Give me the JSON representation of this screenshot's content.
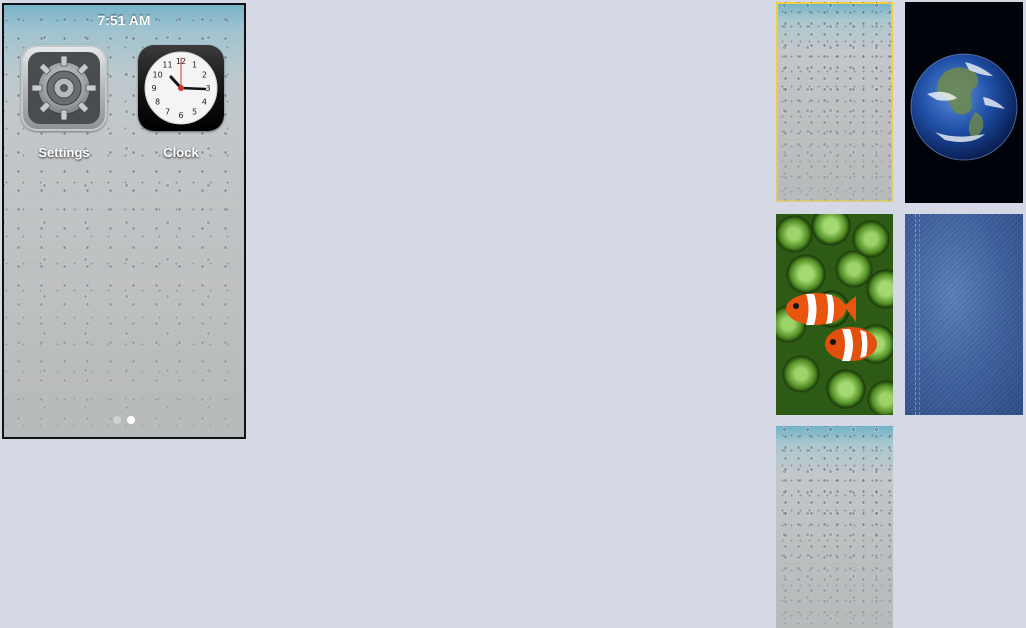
{
  "phone": {
    "status_time": "7:51 AM",
    "apps": [
      {
        "label": "Settings",
        "icon": "settings-gear-icon"
      },
      {
        "label": "Clock",
        "icon": "clock-icon"
      }
    ],
    "clock_numerals": [
      "12",
      "1",
      "2",
      "3",
      "4",
      "5",
      "6",
      "7",
      "8",
      "9",
      "10",
      "11"
    ],
    "page_count": 2,
    "active_page": 2
  },
  "wallpapers": [
    {
      "id": "water-drops",
      "selected": true
    },
    {
      "id": "earth"
    },
    {
      "id": "clownfish"
    },
    {
      "id": "denim"
    },
    {
      "id": "water-drops-2"
    }
  ],
  "colors": {
    "background": "#d5d8e5",
    "selection_border": "#f2cf3b"
  }
}
